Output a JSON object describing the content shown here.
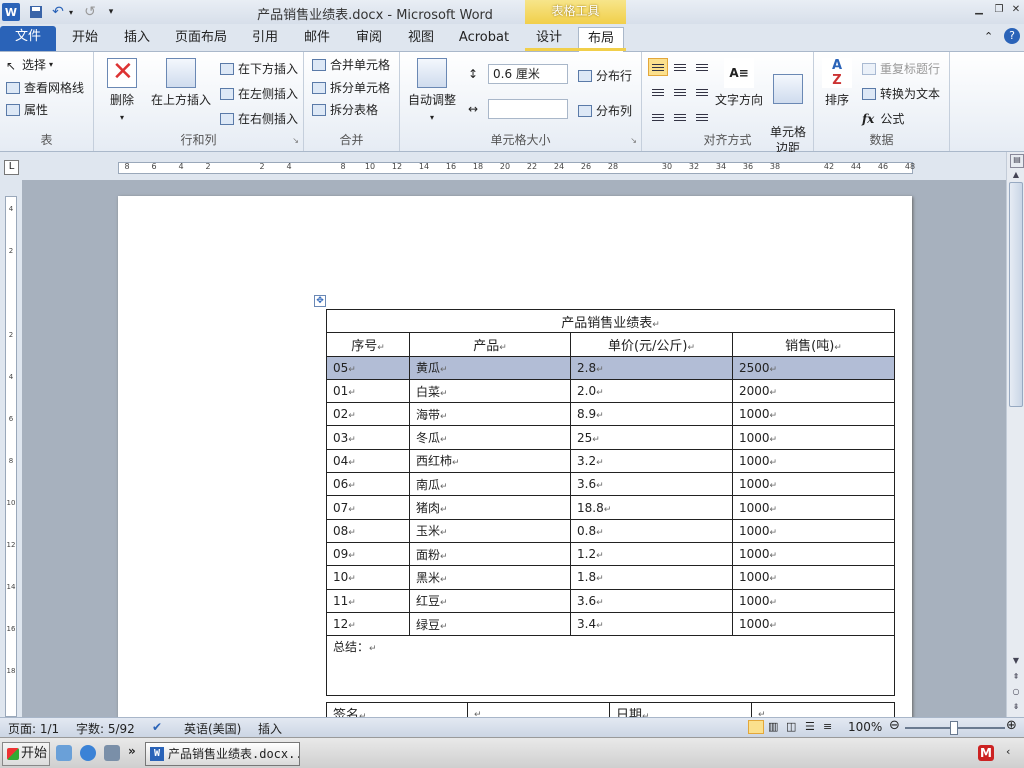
{
  "titlebar": {
    "title": "产品销售业绩表.docx - Microsoft Word",
    "context_group": "表格工具",
    "word_icon": "W"
  },
  "tabs": [
    {
      "label": "文件"
    },
    {
      "label": "开始"
    },
    {
      "label": "插入"
    },
    {
      "label": "页面布局"
    },
    {
      "label": "引用"
    },
    {
      "label": "邮件"
    },
    {
      "label": "审阅"
    },
    {
      "label": "视图"
    },
    {
      "label": "Acrobat"
    },
    {
      "label": "设计"
    },
    {
      "label": "布局"
    }
  ],
  "ribbon": {
    "table_group": {
      "label": "表",
      "select": "选择",
      "gridlines": "查看网格线",
      "properties": "属性"
    },
    "rows_cols_group": {
      "label": "行和列",
      "delete": "删除",
      "insert_above": "在上方插入",
      "insert_below": "在下方插入",
      "insert_left": "在左侧插入",
      "insert_right": "在右侧插入"
    },
    "merge_group": {
      "label": "合并",
      "merge_cells": "合并单元格",
      "split_cells": "拆分单元格",
      "split_table": "拆分表格"
    },
    "cell_size_group": {
      "label": "单元格大小",
      "autofit": "自动调整",
      "height_value": "0.6 厘米",
      "width_value": "",
      "distribute_rows": "分布行",
      "distribute_cols": "分布列"
    },
    "alignment_group": {
      "label": "对齐方式",
      "text_direction": "文字方向",
      "cell_margins": "单元格\n边距"
    },
    "data_group": {
      "label": "数据",
      "sort": "排序",
      "repeat_header": "重复标题行",
      "convert_text": "转换为文本",
      "formula": "公式"
    }
  },
  "document": {
    "table_title": "产品销售业绩表",
    "headers": [
      "序号",
      "产品",
      "单价(元/公斤)",
      "销售(吨)"
    ],
    "rows": [
      [
        "05",
        "黄瓜",
        "2.8",
        "2500"
      ],
      [
        "01",
        "白菜",
        "2.0",
        "2000"
      ],
      [
        "02",
        "海带",
        "8.9",
        "1000"
      ],
      [
        "03",
        "冬瓜",
        "25",
        "1000"
      ],
      [
        "04",
        "西红柿",
        "3.2",
        "1000"
      ],
      [
        "06",
        "南瓜",
        "3.6",
        "1000"
      ],
      [
        "07",
        "猪肉",
        "18.8",
        "1000"
      ],
      [
        "08",
        "玉米",
        "0.8",
        "1000"
      ],
      [
        "09",
        "面粉",
        "1.2",
        "1000"
      ],
      [
        "10",
        "黑米",
        "1.8",
        "1000"
      ],
      [
        "11",
        "红豆",
        "3.6",
        "1000"
      ],
      [
        "12",
        "绿豆",
        "3.4",
        "1000"
      ]
    ],
    "summary_label": "总结：",
    "signature_label": "签名",
    "date_label": "日期"
  },
  "statusbar": {
    "page": "页面: 1/1",
    "words": "字数: 5/92",
    "language": "英语(美国)",
    "mode": "插入",
    "zoom": "100%"
  },
  "taskbar": {
    "start": "开始",
    "task_item": "产品销售业绩表.docx..."
  },
  "ruler": {
    "h_numbers": [
      "8",
      "6",
      "4",
      "2",
      "",
      "2",
      "4",
      "",
      "8",
      "10",
      "12",
      "14",
      "16",
      "18",
      "20",
      "22",
      "24",
      "26",
      "28",
      "",
      "30",
      "32",
      "34",
      "36",
      "38",
      "",
      "42",
      "44",
      "46",
      "48"
    ],
    "v_numbers": [
      "4",
      "2",
      "",
      "2",
      "4",
      "6",
      "8",
      "10",
      "12",
      "14",
      "16",
      "18"
    ]
  },
  "colors": {
    "file_tab": "#2a63b8",
    "context_tab": "#f1cf4a",
    "row_highlight": "#b2bdd6"
  }
}
